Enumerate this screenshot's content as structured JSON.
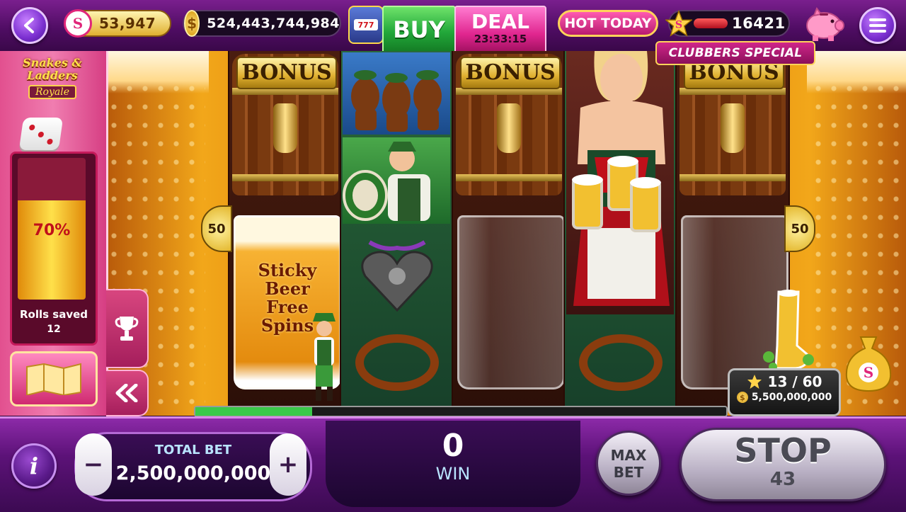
{
  "top_bar": {
    "level_points": "53,947",
    "coin_balance": "524,443,744,984",
    "buy_label": "BUY",
    "deal_label": "DEAL",
    "deal_timer": "23:33:15",
    "hot_today_label": "HOT TODAY",
    "star_points": "16421",
    "clubbers_special_label": "CLUBBERS SPECIAL"
  },
  "left_panel": {
    "logo_line1": "Snakes & Ladders",
    "logo_line2": "Royale",
    "progress_percent": "70%",
    "progress_fraction": 0.7,
    "rolls_saved_label": "Rolls saved",
    "rolls_saved_value": "12"
  },
  "reels": {
    "bonus_text": "BONUS",
    "line_marker": "50",
    "feature_text_1": "Sticky",
    "feature_text_2": "Beer",
    "feature_text_3": "Free",
    "feature_text_4": "Spins"
  },
  "collect_meter": {
    "progress": "13 / 60",
    "prize": "5,500,000,000"
  },
  "bottom_bar": {
    "info_label": "i",
    "minus_label": "−",
    "plus_label": "+",
    "total_bet_label": "TOTAL BET",
    "total_bet_value": "2,500,000,000",
    "win_value": "0",
    "win_label": "WIN",
    "max_bet_line1": "MAX",
    "max_bet_line2": "BET",
    "stop_label": "STOP",
    "stop_count": "43"
  },
  "colors": {
    "accent_purple": "#7a1f8e",
    "pink_panel": "#e2508f",
    "gold": "#f2c230",
    "green_buy": "#22a83a"
  }
}
